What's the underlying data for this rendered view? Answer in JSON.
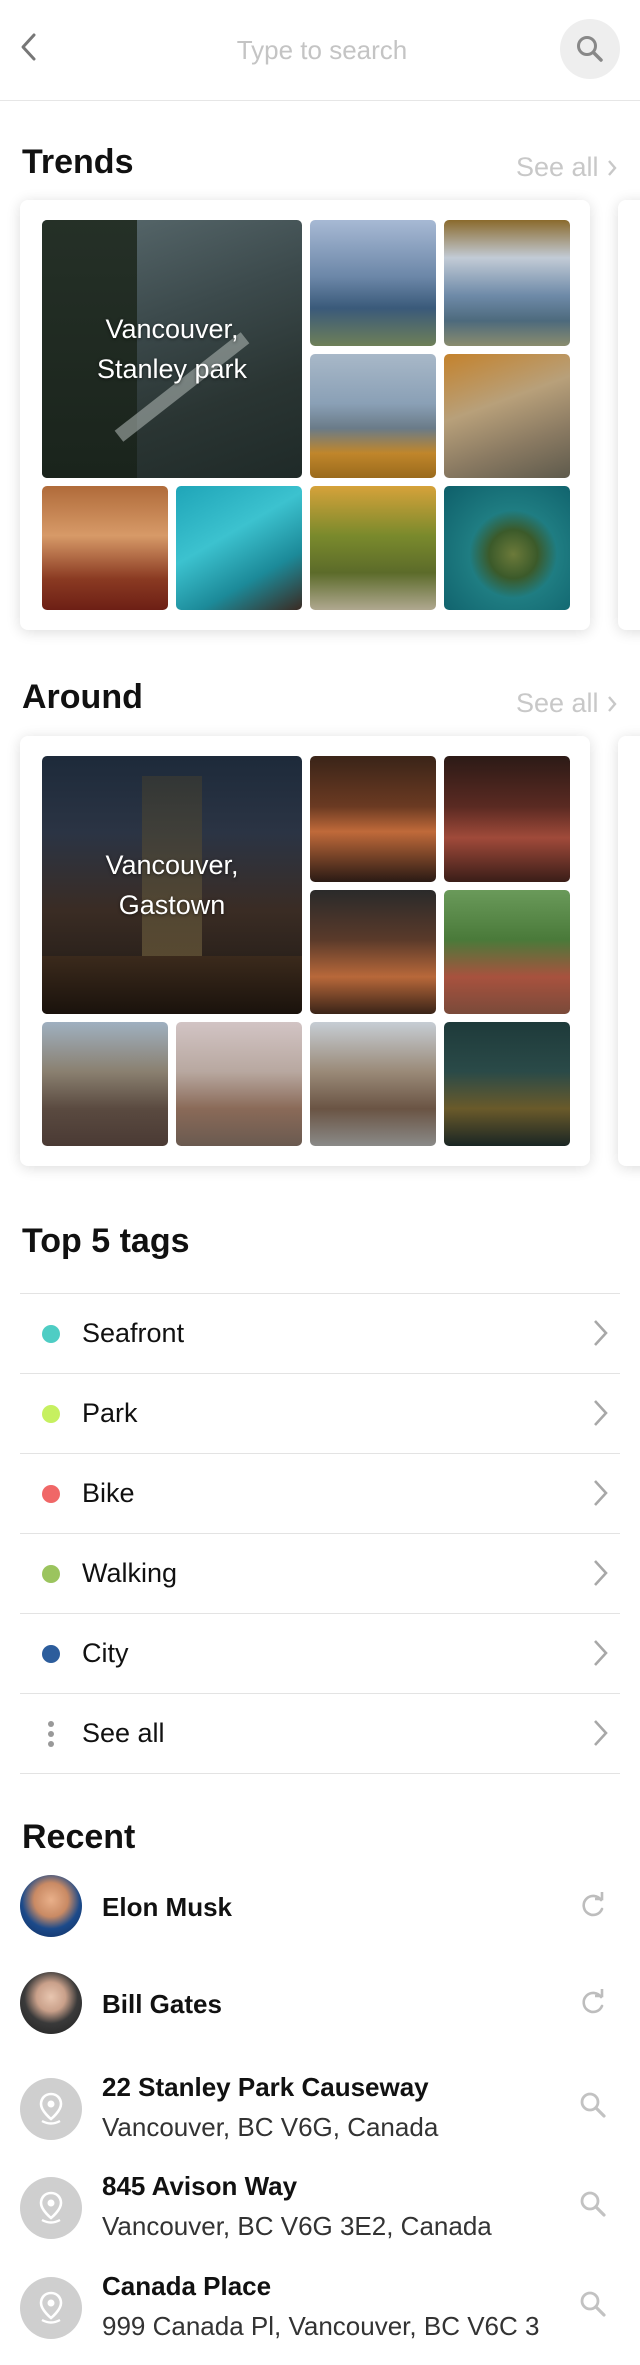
{
  "header": {
    "search_placeholder": "Type to search",
    "back_icon": "chevron-left-icon",
    "search_icon": "search-icon"
  },
  "trends": {
    "title": "Trends",
    "see_all": "See all",
    "feature_line1": "Vancouver,",
    "feature_line2": "Stanley park"
  },
  "around": {
    "title": "Around",
    "see_all": "See all",
    "feature_line1": "Vancouver,",
    "feature_line2": "Gastown"
  },
  "tags": {
    "title": "Top 5 tags",
    "items": [
      {
        "label": "Seafront",
        "color": "#4ecdc4"
      },
      {
        "label": "Park",
        "color": "#c6f060"
      },
      {
        "label": "Bike",
        "color": "#f06767"
      },
      {
        "label": "Walking",
        "color": "#9bc45e"
      },
      {
        "label": "City",
        "color": "#2c5d9c"
      }
    ],
    "see_all": "See all"
  },
  "recent": {
    "title": "Recent",
    "items": [
      {
        "name": "Elon Musk",
        "type": "person",
        "action_icon": "refresh-icon"
      },
      {
        "name": "Bill Gates",
        "type": "person",
        "action_icon": "refresh-icon"
      },
      {
        "name": "22 Stanley Park Causeway",
        "address": "Vancouver, BC V6G, Canada",
        "type": "place",
        "action_icon": "search-icon"
      },
      {
        "name": "845 Avison Way",
        "address": "Vancouver, BC V6G 3E2, Canada",
        "type": "place",
        "action_icon": "search-icon"
      },
      {
        "name": "Canada Place",
        "address": "999 Canada Pl, Vancouver, BC V6C 3",
        "type": "place",
        "action_icon": "search-icon"
      }
    ]
  }
}
